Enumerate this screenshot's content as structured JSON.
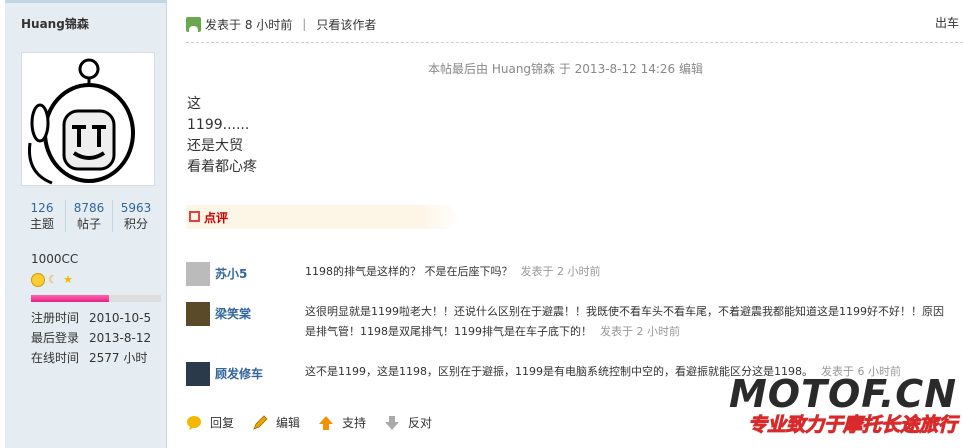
{
  "sidebar": {
    "author": "Huang锦森",
    "stats": [
      {
        "num": "126",
        "label": "主题"
      },
      {
        "num": "8786",
        "label": "帖子"
      },
      {
        "num": "5963",
        "label": "积分"
      }
    ],
    "group": "1000CC",
    "progress": 0.6,
    "info": [
      {
        "k": "注册时间",
        "v": "2010-10-5"
      },
      {
        "k": "最后登录",
        "v": "2013-8-12"
      },
      {
        "k": "在线时间",
        "v": "2577 小时"
      }
    ]
  },
  "post": {
    "posted": "发表于 8 小时前",
    "only_author": "只看该作者",
    "right_link": "出车",
    "edit_note": "本帖最后由 Huang锦森 于 2013-8-12 14:26 编辑",
    "lines": [
      "这",
      "1199......",
      "还是大贸",
      "看着都心疼"
    ]
  },
  "comments_title": "点评",
  "comments": [
    {
      "name": "苏小5",
      "text": "1198的排气是这样的？ 不是在后座下吗？",
      "time": "发表于 2 小时前"
    },
    {
      "name": "梁笑棠",
      "text": "这很明显就是1199啦老大！！还说什么区别在于避震！！我既使不看车头不看车尾，不着避震我都能知道这是1199好不好！！原因是排气管！1198是双尾排气！1199排气是在车子底下的！",
      "time": "发表于 2 小时前"
    },
    {
      "name": "顾发修车",
      "text": "这不是1199，这是1198，区别在于避振，1199是有电脑系统控制中空的，看避振就能区分这是1198。",
      "time": "发表于 6 小时前"
    }
  ],
  "actions": [
    {
      "label": "回复",
      "icon": "reply-icon"
    },
    {
      "label": "编辑",
      "icon": "edit-icon"
    },
    {
      "label": "支持",
      "icon": "support-icon"
    },
    {
      "label": "反对",
      "icon": "oppose-icon"
    }
  ],
  "watermark": {
    "big": "MOTOF.CN",
    "small": "专业致力于摩托长途旅行"
  }
}
